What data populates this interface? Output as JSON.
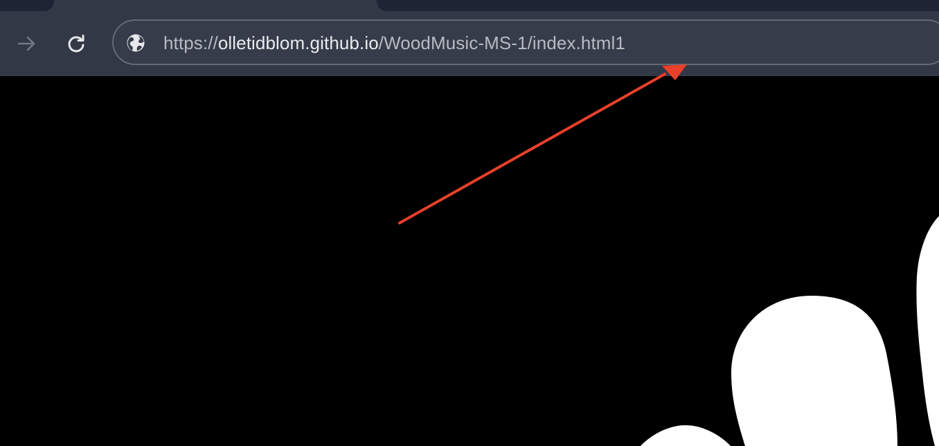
{
  "browser": {
    "toolbar": {
      "forward_icon": "arrow-right-icon",
      "reload_icon": "reload-icon",
      "address_bar": {
        "site_info_icon": "globe-icon",
        "url_scheme": "https://",
        "url_host": "olletidblom.github.io",
        "url_path": "/WoodMusic-MS-1/index.html1"
      }
    },
    "annotation": {
      "type": "arrow",
      "color": "#e8402a"
    }
  }
}
